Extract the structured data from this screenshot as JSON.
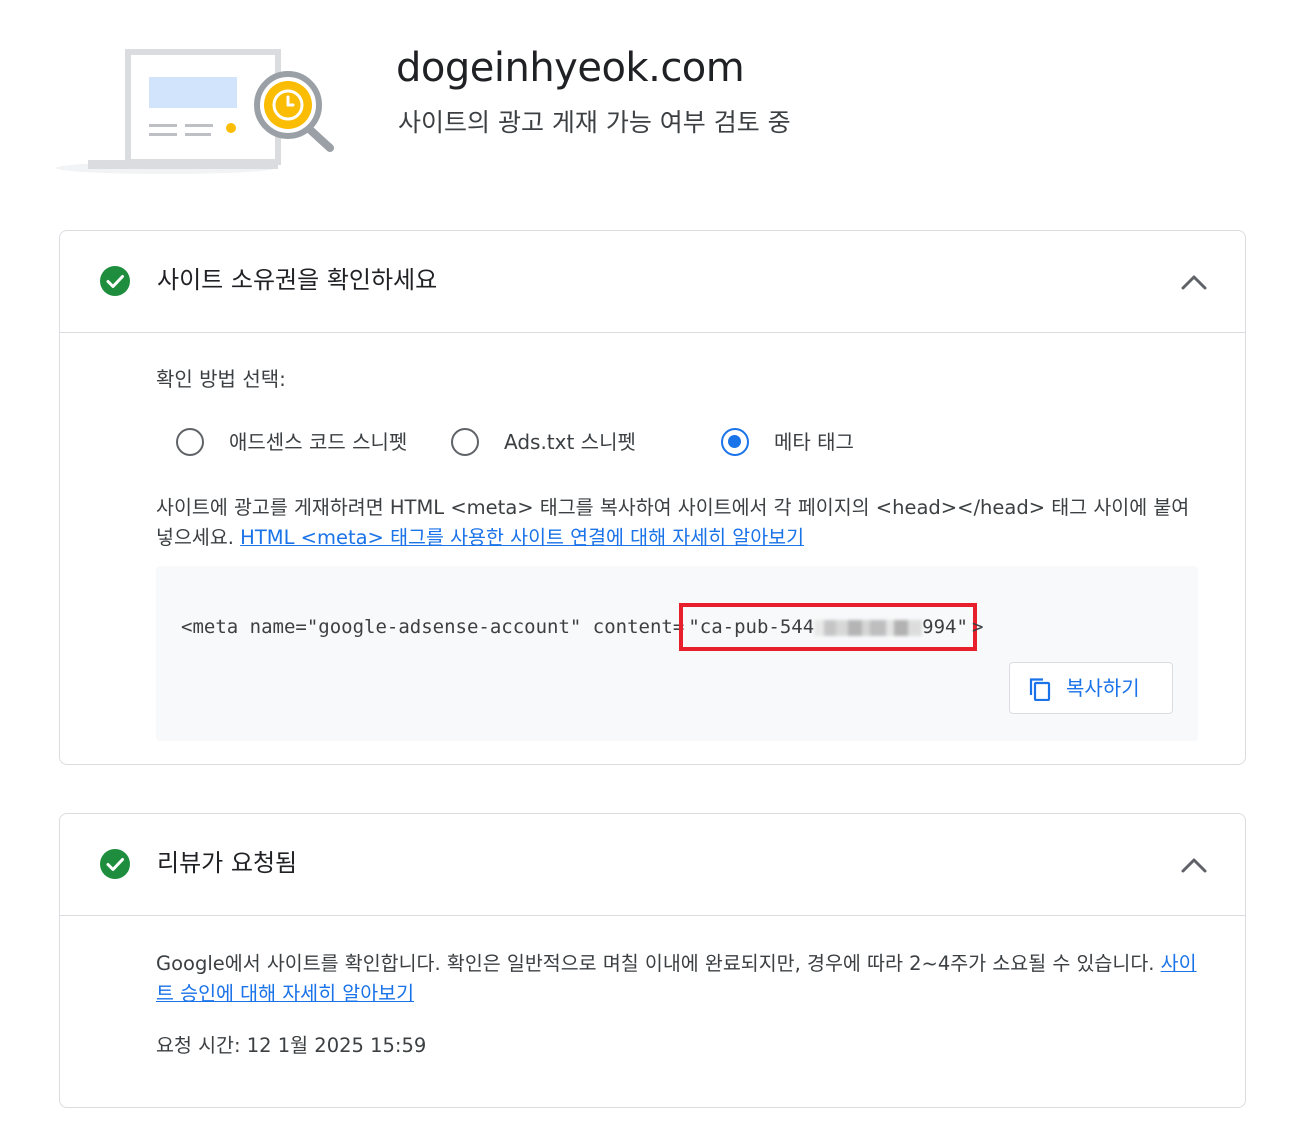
{
  "header": {
    "domain": "dogeinhyeok.com",
    "subtitle": "사이트의 광고 게재 가능 여부 검토 중"
  },
  "ownership_card": {
    "title": "사이트 소유권을 확인하세요",
    "method_label": "확인 방법 선택:",
    "options": [
      {
        "label": "애드센스 코드 스니펫",
        "selected": false
      },
      {
        "label": "Ads.txt 스니펫",
        "selected": false
      },
      {
        "label": "메타 태그",
        "selected": true
      }
    ],
    "description": "사이트에 광고를 게재하려면 HTML <meta> 태그를 복사하여 사이트에서 각 페이지의 <head></head> 태그 사이에 붙여넣으세요.",
    "learn_more_link": "HTML <meta> 태그를 사용한 사이트 연결에 대해 자세히 알아보기",
    "code_prefix": "<meta name=\"google-adsense-account\" content=",
    "code_value_start": "\"ca-pub-544",
    "code_value_end": "994\"",
    "code_suffix": ">",
    "copy_label": "복사하기"
  },
  "review_card": {
    "title": "리뷰가 요청됨",
    "description": "Google에서 사이트를 확인합니다. 확인은 일반적으로 며칠 이내에 완료되지만, 경우에 따라 2~4주가 소요될 수 있습니다.",
    "learn_more_link": "사이트 승인에 대해 자세히 알아보기",
    "request_time": "요청 시간: 12 1월 2025 15:59"
  },
  "colors": {
    "accent": "#1a73e8",
    "success": "#1e8e3e",
    "highlight": "#e8202c",
    "illustration_yellow": "#fbbc04"
  },
  "icons": [
    "site-review-illustration",
    "check-circle-icon",
    "chevron-up-icon",
    "copy-icon"
  ]
}
